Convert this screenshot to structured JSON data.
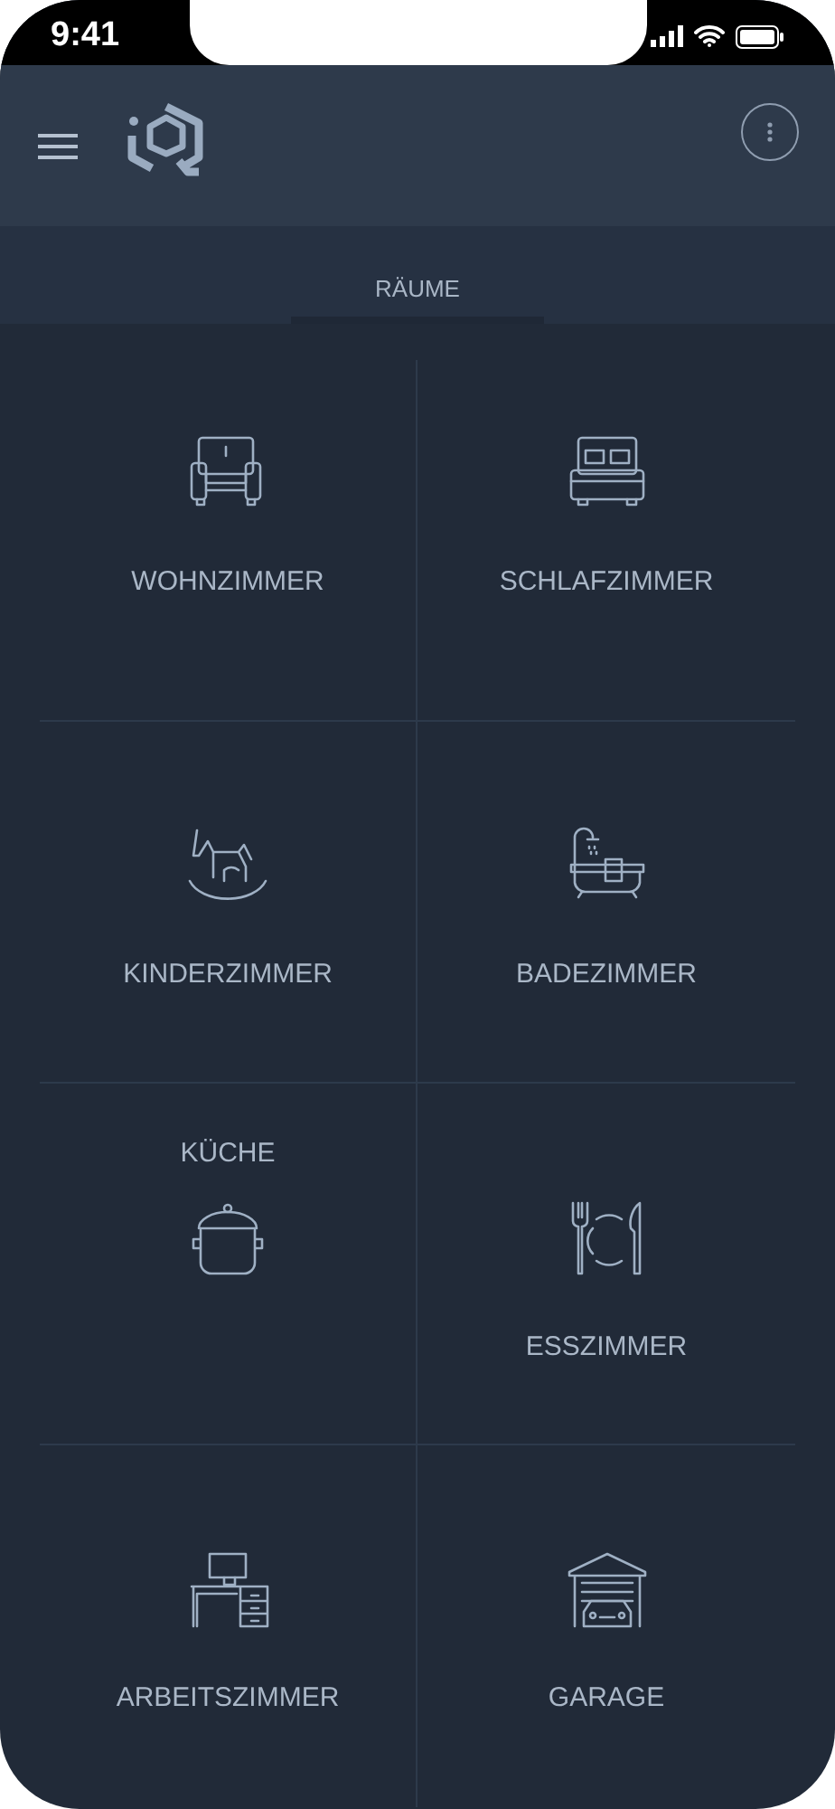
{
  "status_bar": {
    "time": "9:41"
  },
  "tabs": [
    {
      "label": "RÄUME",
      "selected": true
    }
  ],
  "rooms": [
    {
      "label": "WOHNZIMMER",
      "kind": "label-below"
    },
    {
      "label": "SCHLAFZIMMER",
      "kind": "label-below"
    },
    {
      "label": "KINDERZIMMER",
      "kind": "label-below"
    },
    {
      "label": "BADEZIMMER",
      "kind": "label-below"
    },
    {
      "label": "KÜCHE",
      "kind": "label-above"
    },
    {
      "label": "ESSZIMMER",
      "kind": "label-below"
    },
    {
      "label": "ARBEITSZIMMER",
      "kind": "label-below"
    },
    {
      "label": "GARAGE",
      "kind": "label-below"
    }
  ]
}
